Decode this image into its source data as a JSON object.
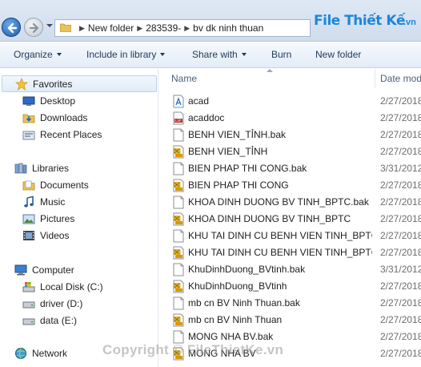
{
  "address": {
    "crumbs": [
      "New folder",
      "283539-",
      "bv dk ninh thuan"
    ]
  },
  "logo": {
    "text": "File Thiết Kế",
    "sub": ".vn"
  },
  "toolbar": {
    "organize": "Organize",
    "include": "Include in library",
    "share": "Share with",
    "burn": "Burn",
    "new_folder": "New folder"
  },
  "nav": {
    "favorites": "Favorites",
    "desktop": "Desktop",
    "downloads": "Downloads",
    "recent": "Recent Places",
    "libraries": "Libraries",
    "documents": "Documents",
    "music": "Music",
    "pictures": "Pictures",
    "videos": "Videos",
    "computer": "Computer",
    "disk_c": "Local Disk (C:)",
    "disk_d": "driver (D:)",
    "disk_e": "data (E:)",
    "network": "Network"
  },
  "columns": {
    "name": "Name",
    "date": "Date mod"
  },
  "files": [
    {
      "name": "acad",
      "date": "2/27/2018",
      "icon": "font-icon"
    },
    {
      "name": "acaddoc",
      "date": "2/27/2018",
      "icon": "lsp-file-icon"
    },
    {
      "name": "BENH VIEN_TỈNH.bak",
      "date": "2/27/2018",
      "icon": "bak-file-icon"
    },
    {
      "name": "BENH VIEN_TỈNH",
      "date": "2/27/2018",
      "icon": "dwg-file-icon"
    },
    {
      "name": "BIEN PHAP THI CONG.bak",
      "date": "3/31/2012",
      "icon": "bak-file-icon"
    },
    {
      "name": "BIEN PHAP THI CONG",
      "date": "2/27/2018",
      "icon": "dwg-file-icon"
    },
    {
      "name": "KHOA DINH DUONG BV TINH_BPTC.bak",
      "date": "2/27/2018",
      "icon": "bak-file-icon"
    },
    {
      "name": "KHOA DINH DUONG BV TINH_BPTC",
      "date": "2/27/2018",
      "icon": "dwg-file-icon"
    },
    {
      "name": "KHU TAI DINH CU BENH VIEN TINH_BPTC.bak",
      "date": "2/27/2018",
      "icon": "bak-file-icon"
    },
    {
      "name": "KHU TAI DINH CU BENH VIEN TINH_BPTC",
      "date": "2/27/2018",
      "icon": "dwg-file-icon"
    },
    {
      "name": "KhuDinhDuong_BVtinh.bak",
      "date": "3/31/2012",
      "icon": "bak-file-icon"
    },
    {
      "name": "KhuDinhDuong_BVtinh",
      "date": "2/27/2018",
      "icon": "dwg-file-icon"
    },
    {
      "name": "mb cn BV Ninh Thuan.bak",
      "date": "2/27/2018",
      "icon": "bak-file-icon"
    },
    {
      "name": "mb cn BV Ninh Thuan",
      "date": "2/27/2018",
      "icon": "dwg-file-icon"
    },
    {
      "name": "MONG NHA BV.bak",
      "date": "2/27/2018",
      "icon": "bak-file-icon"
    },
    {
      "name": "MONG NHA BV",
      "date": "2/27/2018",
      "icon": "dwg-file-icon"
    }
  ],
  "watermark": "Copyright © FileThietKe.vn"
}
